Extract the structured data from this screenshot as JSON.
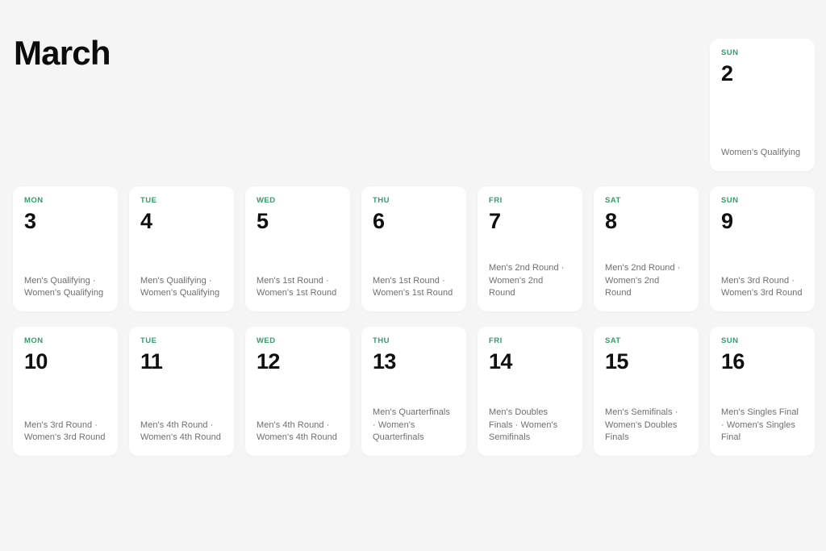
{
  "header": {
    "month_title": "March"
  },
  "colors": {
    "page_background": "#f5f5f5",
    "card_background": "#ffffff",
    "weekday_accent": "#2e9e6b",
    "daynum": "#101010",
    "event_text": "#6f6f6f"
  },
  "calendar": {
    "leading_blank_cells": 6,
    "days": [
      {
        "weekday": "SUN",
        "date": "2",
        "events": "Women's Qualifying"
      },
      {
        "weekday": "MON",
        "date": "3",
        "events": "Men's Qualifying · Women's Qualifying"
      },
      {
        "weekday": "TUE",
        "date": "4",
        "events": "Men's Qualifying · Women's Qualifying"
      },
      {
        "weekday": "WED",
        "date": "5",
        "events": "Men's 1st Round · Women's 1st Round"
      },
      {
        "weekday": "THU",
        "date": "6",
        "events": "Men's 1st Round · Women's 1st Round"
      },
      {
        "weekday": "FRI",
        "date": "7",
        "events": "Men's 2nd Round · Women's 2nd Round"
      },
      {
        "weekday": "SAT",
        "date": "8",
        "events": "Men's 2nd Round · Women's 2nd Round"
      },
      {
        "weekday": "SUN",
        "date": "9",
        "events": "Men's 3rd Round · Women's 3rd Round"
      },
      {
        "weekday": "MON",
        "date": "10",
        "events": "Men's 3rd Round · Women's 3rd Round"
      },
      {
        "weekday": "TUE",
        "date": "11",
        "events": "Men's 4th Round · Women's 4th Round"
      },
      {
        "weekday": "WED",
        "date": "12",
        "events": "Men's 4th Round · Women's 4th Round"
      },
      {
        "weekday": "THU",
        "date": "13",
        "events": "Men's Quarterfinals · Women's Quarterfinals"
      },
      {
        "weekday": "FRI",
        "date": "14",
        "events": "Men's Doubles Finals · Women's Semifinals"
      },
      {
        "weekday": "SAT",
        "date": "15",
        "events": "Men's Semifinals · Women's Doubles Finals"
      },
      {
        "weekday": "SUN",
        "date": "16",
        "events": "Men's Singles Final · Women's Singles Final"
      }
    ]
  }
}
